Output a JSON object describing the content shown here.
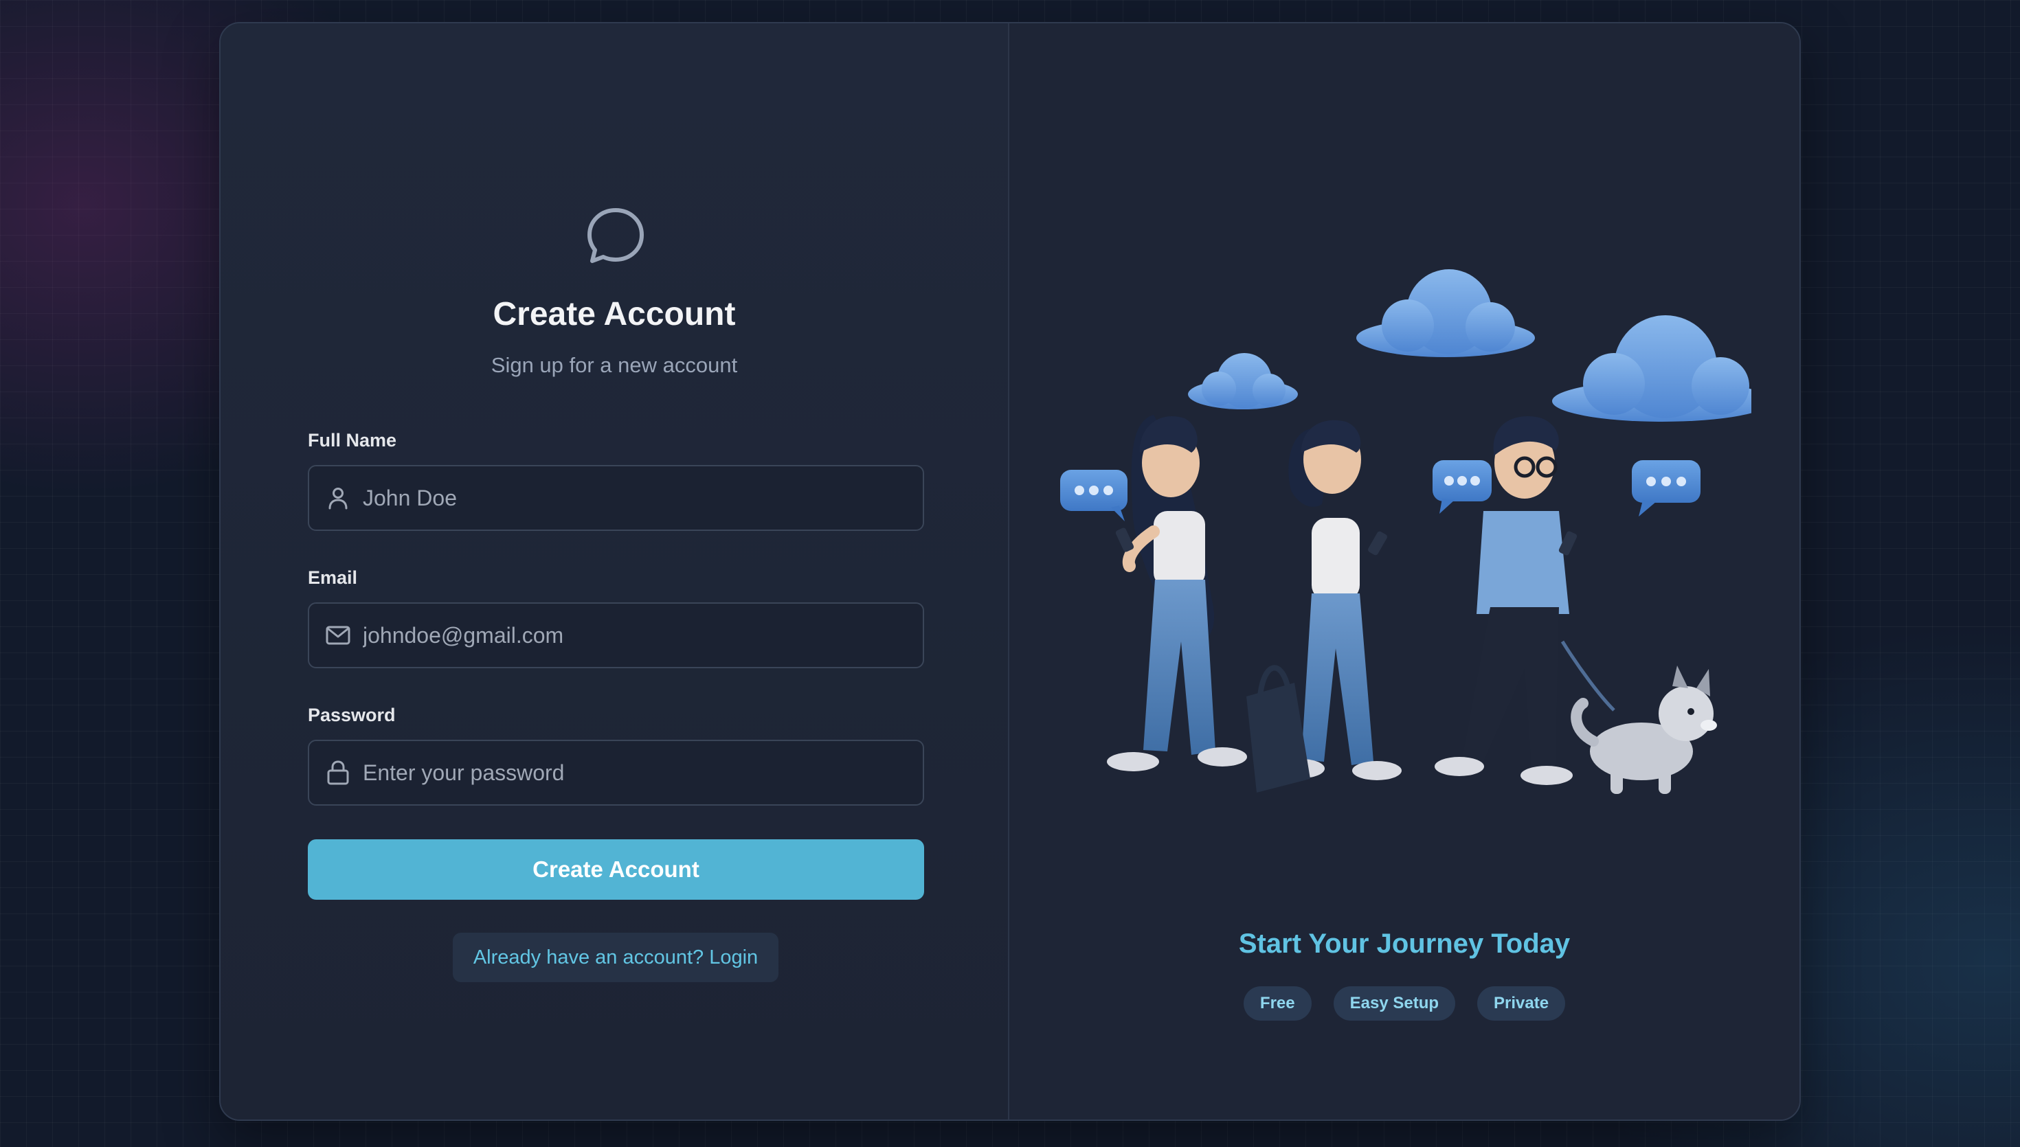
{
  "form": {
    "logo_icon": "chat-bubble-icon",
    "title": "Create Account",
    "subtitle": "Sign up for a new account",
    "full_name": {
      "label": "Full Name",
      "placeholder": "John Doe",
      "icon": "user-icon"
    },
    "email": {
      "label": "Email",
      "placeholder": "johndoe@gmail.com",
      "icon": "mail-icon"
    },
    "password": {
      "label": "Password",
      "placeholder": "Enter your password",
      "icon": "lock-icon"
    },
    "submit_label": "Create Account",
    "login_link": "Already have an account? Login"
  },
  "promo": {
    "headline": "Start Your Journey Today",
    "tags": [
      "Free",
      "Easy Setup",
      "Private"
    ]
  },
  "colors": {
    "accent": "#52b4d4",
    "accent_text": "#60c3e3",
    "card_bg": "#1e2536",
    "page_bg": "#121a2b"
  }
}
